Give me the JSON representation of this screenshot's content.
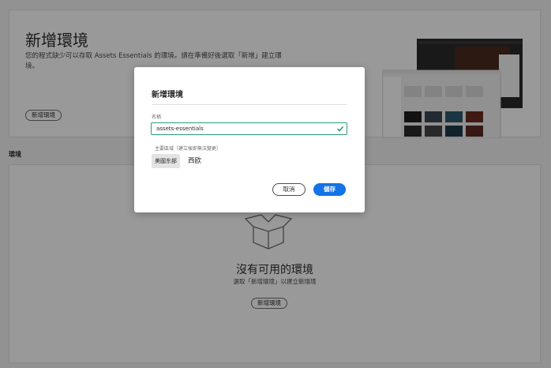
{
  "hero": {
    "title": "新增環境",
    "description": "您的程式缺少可以存取 Assets Essentials 的環境。請在準備好後選取「新增」建立環境。",
    "add_button": "新增環境"
  },
  "environments": {
    "section_label": "環境",
    "empty_title": "沒有可用的環境",
    "empty_subtitle": "選取「新增環境」以建立新環境",
    "add_button": "新增環境"
  },
  "dialog": {
    "title": "新增環境",
    "name_label": "名稱",
    "name_value": "assets-essentials",
    "region_label": "主要區域（建立後即無法變更）",
    "region_options": [
      "美國东部",
      "西欧"
    ],
    "selected_region": "美國东部",
    "cancel_label": "取消",
    "save_label": "儲存"
  },
  "colors": {
    "accent": "#1473e6",
    "valid": "#2d9d78",
    "overlay": "rgba(0,0,0,0.40)"
  },
  "icons": [
    "open-box-icon",
    "checkmark-icon"
  ]
}
